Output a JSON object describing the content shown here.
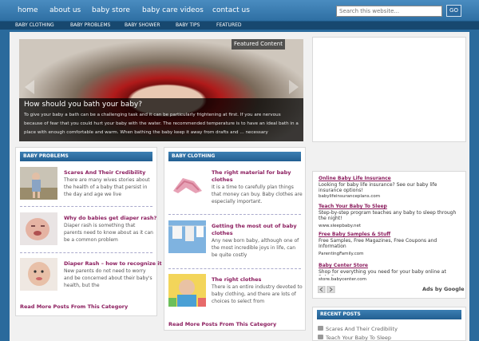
{
  "topnav": {
    "links": [
      "home",
      "about us",
      "baby store",
      "baby care videos",
      "contact us"
    ],
    "search_placeholder": "Search this website...",
    "search_button": "GO"
  },
  "catnav": {
    "items": [
      "BABY CLOTHING",
      "BABY PROBLEMS",
      "BABY SHOWER",
      "BABY TIPS",
      "FEATURED"
    ]
  },
  "featured": {
    "label": "Featured Content",
    "title": "How should you bath your baby?",
    "excerpt": "To give your baby a bath can be a challenging task and it can be particularly frightening at first. If you are nervous because of fear that you could hurt your baby with the water. The recommended temperature is to have an ideal bath in a place with enough comfortable and warm. When bathing the baby keep it away from drafts and ... necessary"
  },
  "baby_problems": {
    "heading": "BABY PROBLEMS",
    "posts": [
      {
        "title": "Scares And Their Credibility",
        "excerpt": "There are many wives stories about the health of a baby that persist in the day and age we live"
      },
      {
        "title": "Why do babies get diaper rash?",
        "excerpt": "Diaper rash is something that parents need to know about as it can be a common problem"
      },
      {
        "title": "Diaper Rash – how to recognize it",
        "excerpt": "New parents do not need to worry and be concerned about their baby's health, but the"
      }
    ],
    "read_more": "Read More Posts From This Category"
  },
  "baby_clothing": {
    "heading": "BABY CLOTHING",
    "posts": [
      {
        "title_l1": "The right material for baby",
        "title_l2": "clothes",
        "excerpt": "It is a time to carefully plan things that money can buy. Baby clothes are especially important."
      },
      {
        "title_l1": "Getting the most out of baby",
        "title_l2": "clothes",
        "excerpt": "Any new born baby, although one of the most incredible joys in life, can be quite costly"
      },
      {
        "title_l1": "The right clothes",
        "title_l2": "",
        "excerpt": "There is an entire industry devoted to baby clothing, and there are lots of choices to select from"
      }
    ],
    "read_more": "Read More Posts From This Category"
  },
  "ads": {
    "items": [
      {
        "title": "Online Baby Life Insurance",
        "text": "Looking for baby life insurance? See our baby life insurance options!",
        "url": "babylifeinsuranceplans.com"
      },
      {
        "title": "Teach Your Baby To Sleep",
        "text": "Step-by-step program teaches any baby to sleep through the night!",
        "url": "www.sleepbaby.net"
      },
      {
        "title": "Free Baby Samples & Stuff",
        "text": "Free Samples, Free Magazines, Free Coupons and Information",
        "url": "ParentingFamily.com"
      },
      {
        "title": "Baby Center Store",
        "text": "Shop for everything you need for your baby online at BabyCenter",
        "url": "store.babycenter.com"
      }
    ],
    "ads_by": "Ads by Google"
  },
  "recent_posts": {
    "heading": "RECENT POSTS",
    "items": [
      "Scares And Their Credibility",
      "Teach Your Baby To Sleep"
    ]
  }
}
